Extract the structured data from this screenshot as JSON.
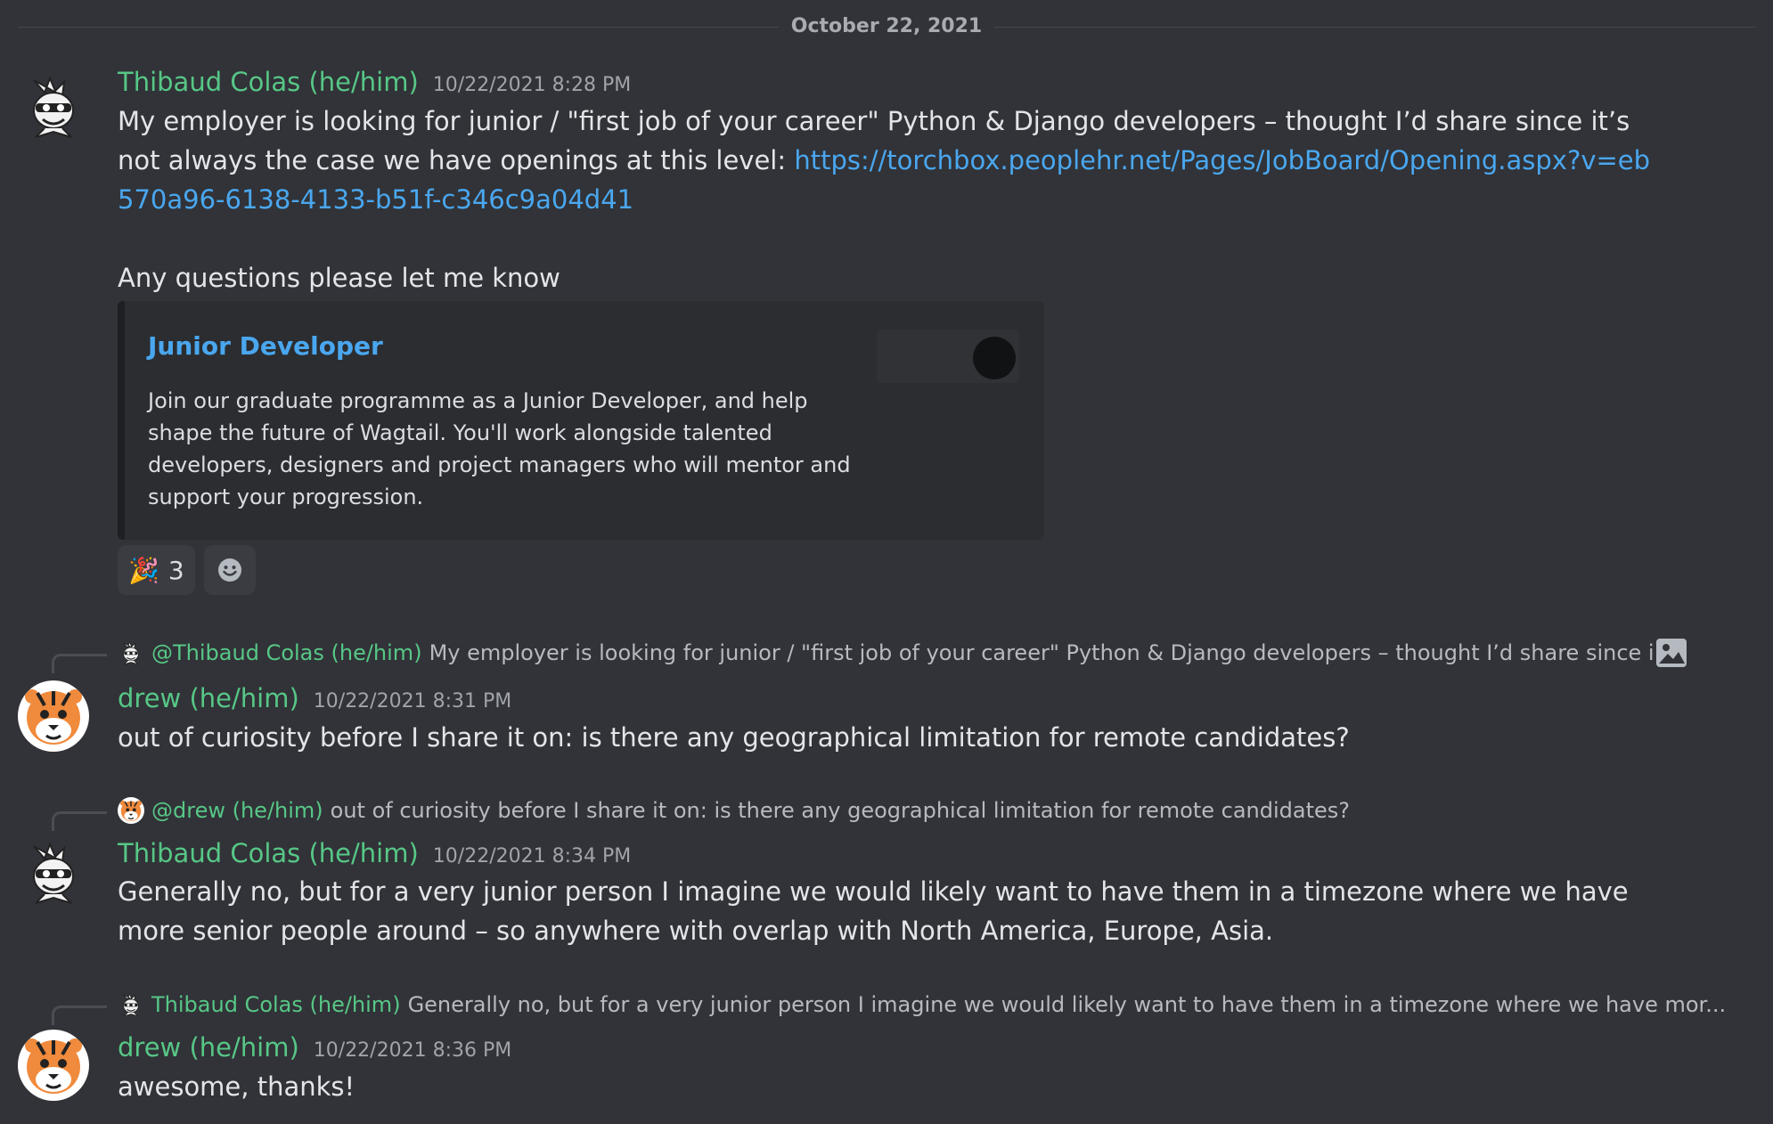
{
  "divider": {
    "date": "October 22, 2021"
  },
  "messages": [
    {
      "author": "Thibaud Colas (he/him)",
      "timestamp": "10/22/2021 8:28 PM",
      "text_pre_link": "My employer is looking for junior / \"first job of your career\" Python & Django developers – thought I’d share since it’s not always the case we have openings at this level: ",
      "link": "https://torchbox.peoplehr.net/Pages/JobBoard/Opening.aspx?v=eb570a96-6138-4133-b51f-c346c9a04d41",
      "text_after": "Any questions please let me know",
      "embed": {
        "title": "Junior Developer",
        "description": "Join our graduate programme as a Junior Developer, and help shape the future of Wagtail. You'll work alongside talented developers, designers and project managers who will mentor and support your progression."
      },
      "reactions": [
        {
          "emoji": "🎉",
          "count": "3"
        }
      ],
      "add_reaction_icon": "smile-icon"
    },
    {
      "reply_to": {
        "author": "@Thibaud Colas (he/him)",
        "text": "My employer is looking for junior / \"first job of your career\" Python & Django developers – thought I’d share since i...",
        "attachment_icon": "image-icon"
      },
      "author": "drew (he/him)",
      "timestamp": "10/22/2021 8:31 PM",
      "text": "out of curiosity before I share it on: is there any geographical limitation for remote candidates?"
    },
    {
      "reply_to": {
        "author": "@drew (he/him)",
        "text": "out of curiosity before I share it on: is there any geographical limitation for remote candidates?"
      },
      "author": "Thibaud Colas (he/him)",
      "timestamp": "10/22/2021 8:34 PM",
      "text": "Generally no, but for a very junior person I imagine we would likely want to have them in a timezone where we have more senior people around – so anywhere with overlap with North America, Europe, Asia."
    },
    {
      "reply_to": {
        "author": "Thibaud Colas (he/him)",
        "text": "Generally no, but for a very junior person I imagine we would likely want to have them in a timezone where we have mor..."
      },
      "author": "drew (he/him)",
      "timestamp": "10/22/2021 8:36 PM",
      "text": "awesome, thanks!"
    }
  ],
  "colors": {
    "background": "#313338",
    "author": "#57c786",
    "link": "#4aa7ef",
    "embed_bg": "#2b2d31"
  }
}
